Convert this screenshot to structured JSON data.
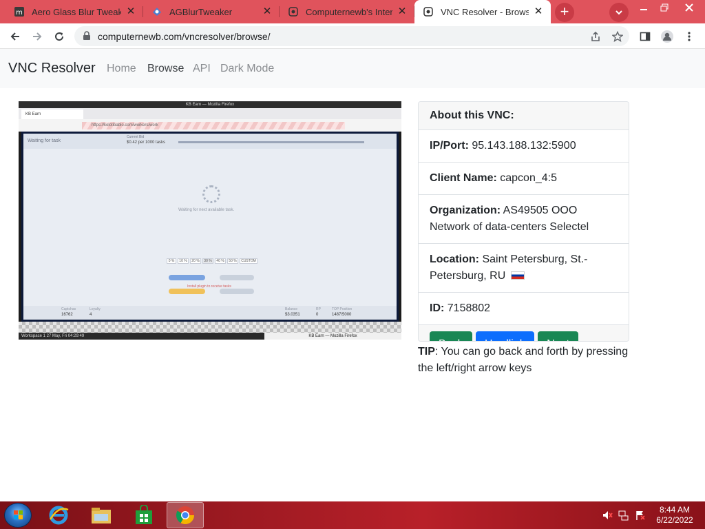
{
  "browser": {
    "tabs": [
      {
        "title": "Aero Glass Blur Tweaker",
        "favicon": "wiki-icon",
        "active": false
      },
      {
        "title": "AGBlurTweaker",
        "favicon": "app-icon",
        "active": false
      },
      {
        "title": "Computernewb's Interne",
        "favicon": "computernewb-icon",
        "active": false
      },
      {
        "title": "VNC Resolver - Browse",
        "favicon": "computernewb-icon",
        "active": true
      }
    ],
    "new_tab_label": "+",
    "url": "computernewb.com/vncresolver/browse/"
  },
  "site": {
    "brand": "VNC Resolver",
    "nav": [
      "Home",
      "Browse",
      "API",
      "Dark Mode"
    ],
    "active_nav": "Browse"
  },
  "vnc": {
    "header": "About this VNC:",
    "ip_label": "IP/Port:",
    "ip_value": "95.143.188.132:5900",
    "client_label": "Client Name:",
    "client_value": "capcon_4:5",
    "org_label": "Organization:",
    "org_value": "AS49505 OOO Network of data-centers Selectel",
    "location_label": "Location:",
    "location_value": "Saint Petersburg, St.-Petersburg, RU",
    "id_label": "ID:",
    "id_value": "7158802",
    "buttons": {
      "back": "Back",
      "hardlink": "Hardlink",
      "next": "Next"
    },
    "tip_label": "TIP",
    "tip_text": ": You can go back and forth by pressing the left/right arrow keys"
  },
  "screenshot": {
    "window_title": "KB Earn — Mozilla Firefox",
    "tab_title": "KB Earn",
    "url": "https://kolotibablo.com/workers/work",
    "status": "Waiting for task",
    "rate_label": "Current Bid",
    "rate": "$0.42 per 1000 tasks",
    "waiting_text": "Waiting for next available task.",
    "percent_options": [
      "0 %",
      "10 %",
      "20 %",
      "30 %",
      "40 %",
      "50 %",
      "CUSTOM"
    ],
    "install_link": "Install plugin to receive tasks",
    "stats": [
      {
        "label": "Captchas",
        "value": "16762"
      },
      {
        "label": "Loyalty",
        "value": "4"
      },
      {
        "label": "Balance",
        "value": "$3.0351"
      },
      {
        "label": "RP",
        "value": "0"
      },
      {
        "label": "TOP Position",
        "value": "1487/5000"
      }
    ],
    "taskbar_left": "Workspace 1  27 May, Fri 04:29:49",
    "taskbar_item": "KB Earn — Mozilla Firefox"
  },
  "taskbar": {
    "time": "8:44 AM",
    "date": "6/22/2022",
    "apps": [
      "internet-explorer-icon",
      "file-explorer-icon",
      "store-icon",
      "chrome-icon"
    ],
    "active_app": "chrome-icon"
  },
  "colors": {
    "tabstrip": "#e0535c",
    "btn_green": "#198754",
    "btn_blue": "#0d6efd",
    "taskbar": "#9e1a22"
  }
}
